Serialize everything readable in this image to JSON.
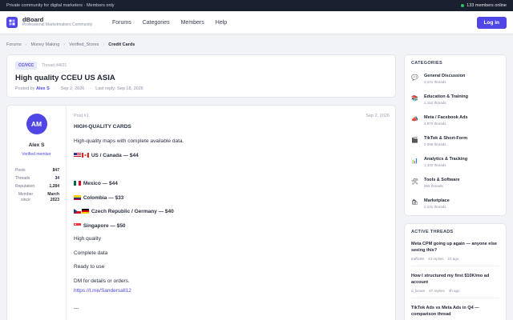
{
  "topbar": {
    "left": "Private community for digital marketers · Members only",
    "online": "133 members online"
  },
  "header": {
    "brand": "dBoard",
    "tagline": "Professional Marketmakers Community",
    "nav": [
      "Forums",
      "Categories",
      "Members",
      "Help"
    ],
    "login": "Log in"
  },
  "breadcrumbs": [
    "Forums",
    "Money Making",
    "Verified_Stores",
    "Credit Cards"
  ],
  "thread": {
    "badge": "CC/VCC",
    "id": "Thread #4821",
    "title": "High quality CCEU US ASIA",
    "posted_by_label": "Posted by",
    "author": "Alex S",
    "date": "Sep 2, 2026",
    "last_reply": "Last reply: Sep 18, 2026"
  },
  "post": {
    "number": "Post #1",
    "date": "Sep 2, 2026",
    "user": {
      "initials": "AM",
      "name": "Alex S",
      "role": "Verified member",
      "stats": [
        {
          "label": "Posts",
          "value": "847"
        },
        {
          "label": "Threads",
          "value": "34"
        },
        {
          "label": "Reputation",
          "value": "1,284"
        }
      ],
      "since_label": "Member since",
      "since_value": "March 2023"
    },
    "lines": {
      "heading": "HIGH-QUALITY CARDS",
      "intro": "High-quality maps with complete available data.",
      "us_ca": "US / Canada — $44",
      "mexico": "Mexico — $44",
      "colombia": "Colombia — $33",
      "europe": "Czech Republic / Germany — $40",
      "singapore": "Singapore — $50",
      "quality": "High quality",
      "complete": "Complete data",
      "ready": "Ready to use",
      "dm": "DM for details or orders.",
      "link": "https://t.me/Sandersall12",
      "divider": "---"
    }
  },
  "categories": {
    "title": "CATEGORIES",
    "items": [
      {
        "icon": "chat-icon",
        "glyph": "💬",
        "name": "General Discussion",
        "count": "3,241 threads"
      },
      {
        "icon": "book-icon",
        "glyph": "📚",
        "name": "Education & Training",
        "count": "1,152 threads"
      },
      {
        "icon": "megaphone-icon",
        "glyph": "📣",
        "name": "Meta / Facebook Ads",
        "count": "4,870 threads"
      },
      {
        "icon": "clapper-icon",
        "glyph": "🎬",
        "name": "TikTok & Short-Form",
        "count": "2,095 threads"
      },
      {
        "icon": "chart-icon",
        "glyph": "📊",
        "name": "Analytics & Tracking",
        "count": "1,340 threads"
      },
      {
        "icon": "tools-icon",
        "glyph": "🛠",
        "name": "Tools & Software",
        "count": "955 threads"
      },
      {
        "icon": "shop-icon",
        "glyph": "🛍",
        "name": "Marketplace",
        "count": "2,231 threads"
      }
    ]
  },
  "active": {
    "title": "ACTIVE THREADS",
    "items": [
      {
        "title": "Meta CPM going up again — anyone else seeing this?",
        "user": "traffic99",
        "replies": "43 replies",
        "time": "1h ago"
      },
      {
        "title": "How I structured my first $10K/mo ad account",
        "user": "d_brown",
        "replies": "67 replies",
        "time": "3h ago"
      },
      {
        "title": "TikTok Ads vs Meta Ads in Q4 — comparison thread",
        "user": "",
        "replies": "",
        "time": ""
      }
    ]
  }
}
